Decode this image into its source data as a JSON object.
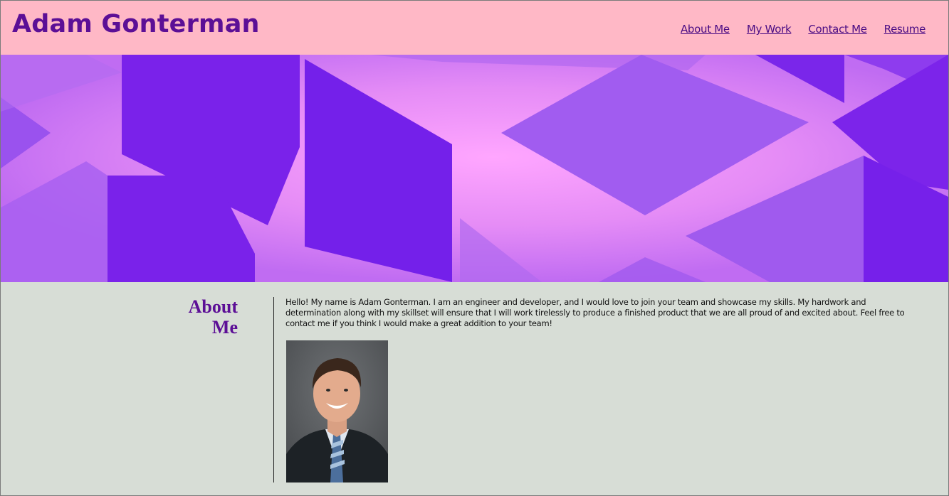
{
  "header": {
    "site_title": "Adam Gonterman",
    "nav": [
      {
        "label": "About Me"
      },
      {
        "label": "My Work"
      },
      {
        "label": "Contact Me"
      },
      {
        "label": "Resume"
      }
    ]
  },
  "about": {
    "heading_line1": "About",
    "heading_line2": "Me",
    "paragraph": "Hello! My name is Adam Gonterman. I am an engineer and developer, and I would love to join your team and showcase my skills. My hardwork and determination along with my skillset will ensure that I will work tirelessly to produce a finished product that we are all proud of and excited about. Feel free to contact me if you think I would make a great addition to your team!"
  },
  "colors": {
    "header_bg": "#ffb8c6",
    "accent_purple": "#5c0f96",
    "section_bg": "#d7ddd6",
    "hero_purple": "#8a2cf0",
    "hero_pink": "#ff9cf8"
  }
}
